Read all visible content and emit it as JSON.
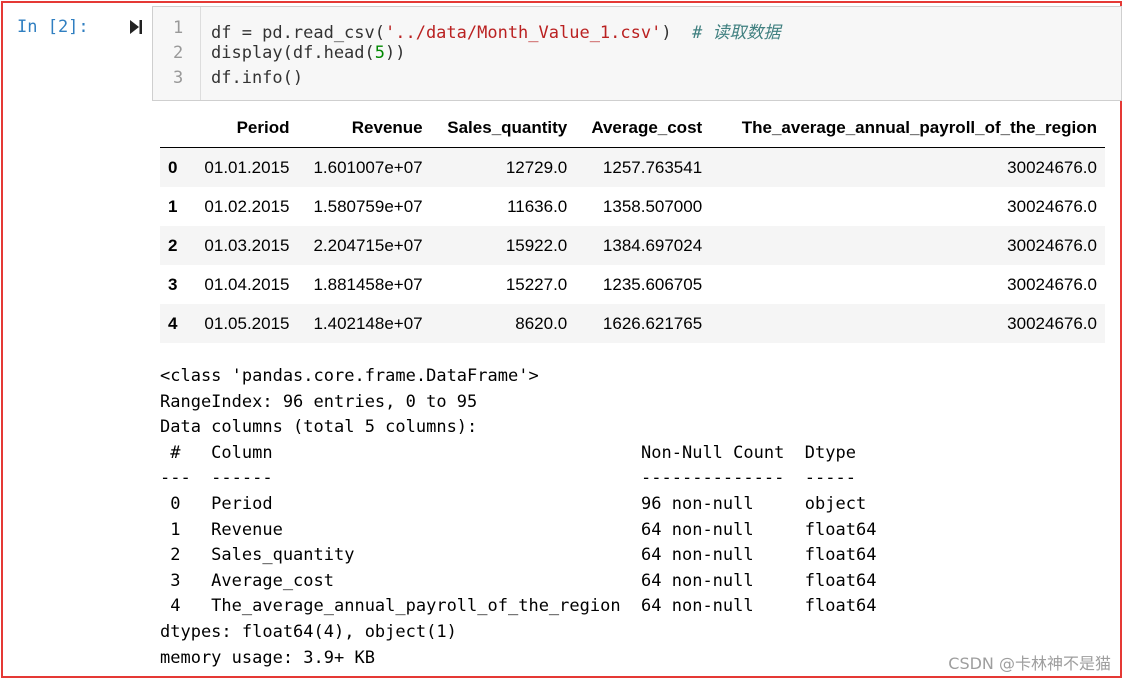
{
  "cell": {
    "prompt": "In  [2]:",
    "line_numbers": [
      "1",
      "2",
      "3"
    ],
    "code": {
      "l1": {
        "a": "df = pd.read_csv(",
        "s": "'../data/Month_Value_1.csv'",
        "b": ")  ",
        "c": "# 读取数据"
      },
      "l2": {
        "a": "display(df.head(",
        "n": "5",
        "b": "))"
      },
      "l3": "df.info()"
    }
  },
  "table": {
    "headers": [
      "",
      "Period",
      "Revenue",
      "Sales_quantity",
      "Average_cost",
      "The_average_annual_payroll_of_the_region"
    ],
    "rows": [
      [
        "0",
        "01.01.2015",
        "1.601007e+07",
        "12729.0",
        "1257.763541",
        "30024676.0"
      ],
      [
        "1",
        "01.02.2015",
        "1.580759e+07",
        "11636.0",
        "1358.507000",
        "30024676.0"
      ],
      [
        "2",
        "01.03.2015",
        "2.204715e+07",
        "15922.0",
        "1384.697024",
        "30024676.0"
      ],
      [
        "3",
        "01.04.2015",
        "1.881458e+07",
        "15227.0",
        "1235.606705",
        "30024676.0"
      ],
      [
        "4",
        "01.05.2015",
        "1.402148e+07",
        "8620.0",
        "1626.621765",
        "30024676.0"
      ]
    ]
  },
  "info_lines": [
    "<class 'pandas.core.frame.DataFrame'>",
    "RangeIndex: 96 entries, 0 to 95",
    "Data columns (total 5 columns):",
    " #   Column                                    Non-Null Count  Dtype",
    "---  ------                                    --------------  -----",
    " 0   Period                                    96 non-null     object",
    " 1   Revenue                                   64 non-null     float64",
    " 2   Sales_quantity                            64 non-null     float64",
    " 3   Average_cost                              64 non-null     float64",
    " 4   The_average_annual_payroll_of_the_region  64 non-null     float64",
    "dtypes: float64(4), object(1)",
    "memory usage: 3.9+ KB"
  ],
  "watermark": "CSDN @卡林神不是猫",
  "icons": {
    "run": "step-run-icon"
  },
  "colors": {
    "border": "#e53935",
    "prompt": "#307fc1",
    "string": "#ba2121",
    "number": "#008800",
    "comment": "#408080"
  }
}
